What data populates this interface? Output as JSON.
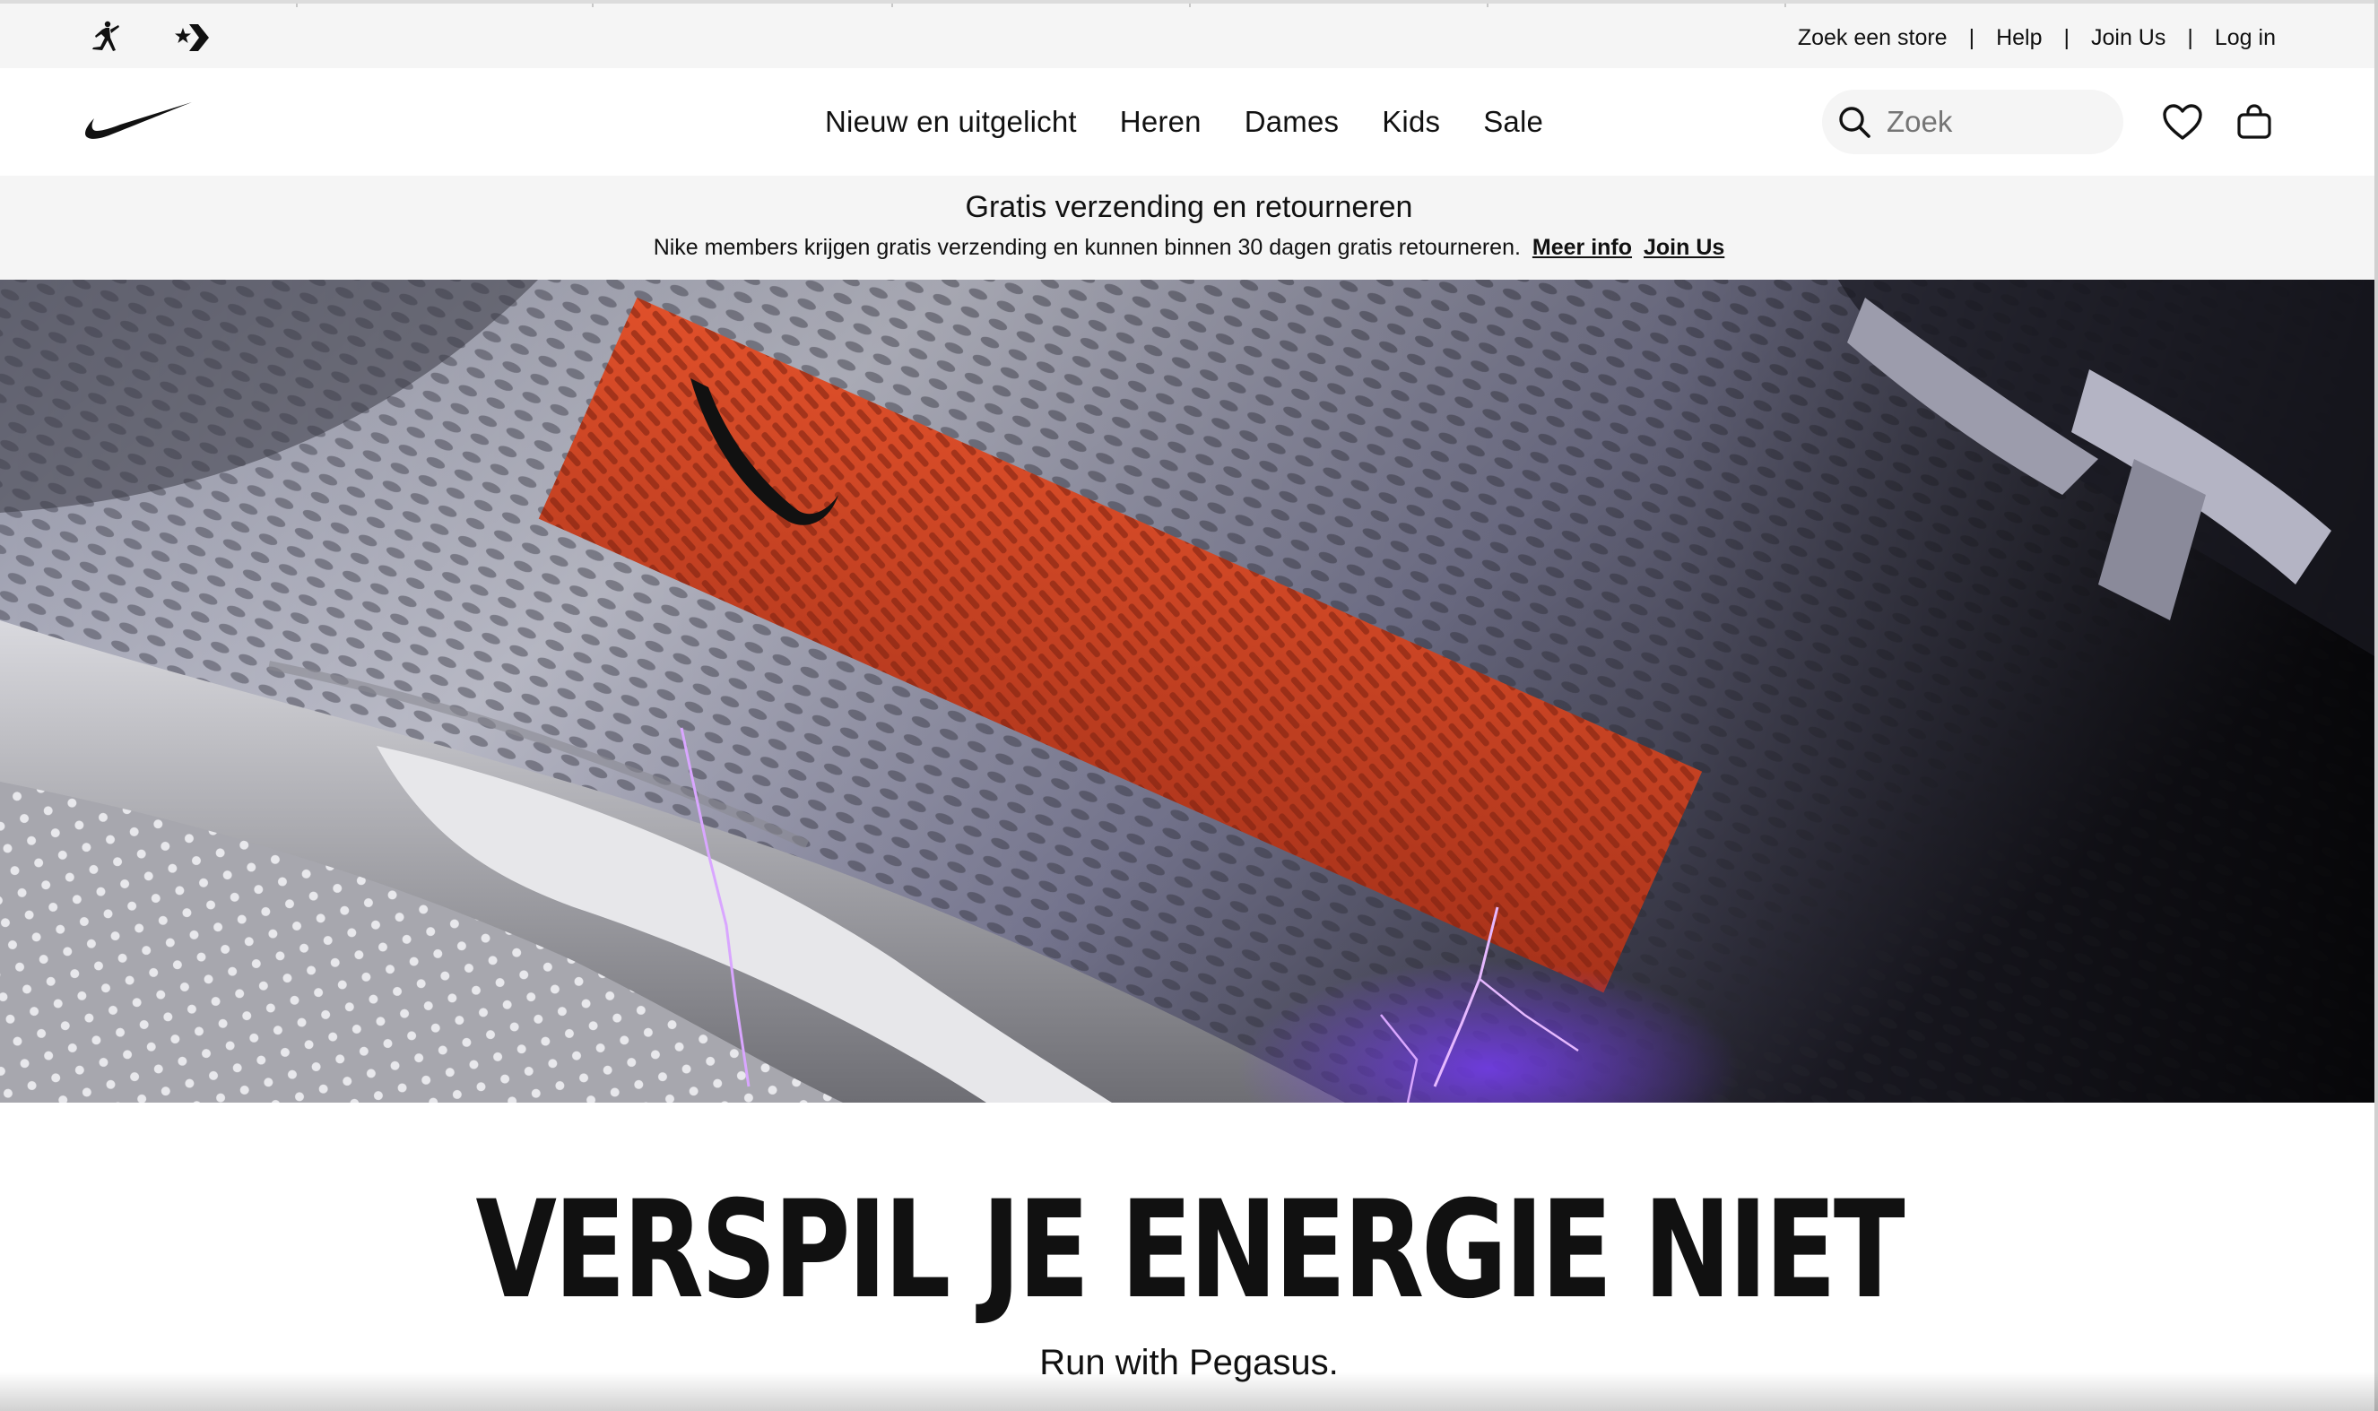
{
  "utility": {
    "brands": [
      {
        "icon": "jordan-jumpman-icon"
      },
      {
        "icon": "converse-star-chevron-icon"
      }
    ],
    "links": [
      {
        "label": "Zoek een store"
      },
      {
        "label": "Help"
      },
      {
        "label": "Join Us"
      },
      {
        "label": "Log in"
      }
    ],
    "separator": "|"
  },
  "nav": {
    "logo_icon": "nike-swoosh-icon",
    "items": [
      {
        "label": "Nieuw en uitgelicht"
      },
      {
        "label": "Heren"
      },
      {
        "label": "Dames"
      },
      {
        "label": "Kids"
      },
      {
        "label": "Sale"
      }
    ],
    "search": {
      "placeholder": "Zoek",
      "icon": "search-icon"
    },
    "favorites_icon": "heart-icon",
    "bag_icon": "shopping-bag-icon"
  },
  "promo": {
    "title": "Gratis verzending en retourneren",
    "text": "Nike members krijgen gratis verzending en kunnen binnen 30 dagen gratis retourneren.",
    "link_more": "Meer info",
    "link_join": "Join Us"
  },
  "hero": {
    "image": "close-up-pegasus-shoe-mesh-orange-swoosh-panel"
  },
  "content": {
    "headline": "VERSPIL JE ENERGIE NIET",
    "subhead": "Run with Pegasus."
  },
  "colors": {
    "text": "#111111",
    "bar_bg": "#f5f5f5",
    "accent_orange": "#d2461e",
    "glow_purple": "#7a3cff"
  }
}
